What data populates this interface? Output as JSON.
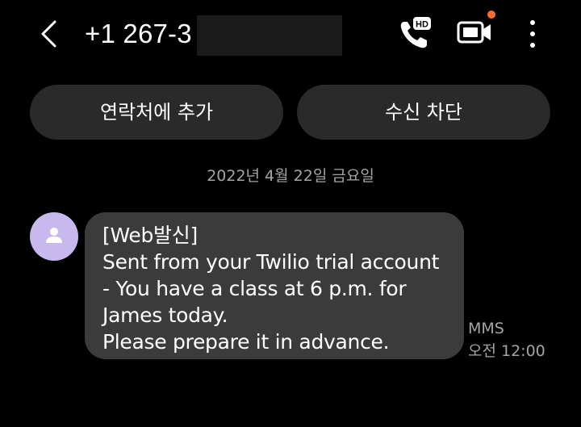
{
  "header": {
    "title": "+1 267-3",
    "actions": {
      "back_icon": "chevron-left-icon",
      "call_icon": "hd-voice-call-icon",
      "call_badge": "HD",
      "video_icon": "video-call-icon",
      "more_icon": "more-vertical-icon",
      "notification_dot_color": "#ff6a2b"
    }
  },
  "actions": {
    "add_contact_label": "연락처에 추가",
    "block_label": "수신 차단"
  },
  "conversation": {
    "date_label": "2022년 4월 22일 금요일",
    "messages": [
      {
        "lines": [
          "[Web발신]",
          "Sent from your Twilio trial account",
          "- You have a class at 6 p.m. for",
          "James today.",
          "Please prepare it in advance."
        ],
        "type_label": "MMS",
        "time_label": "오전 12:00"
      }
    ]
  },
  "colors": {
    "background": "#000000",
    "pill_background": "#2a2a2a",
    "bubble_background": "#3b3b3b",
    "avatar_background": "#c7b8ee",
    "secondary_text": "#a5a5a5"
  }
}
